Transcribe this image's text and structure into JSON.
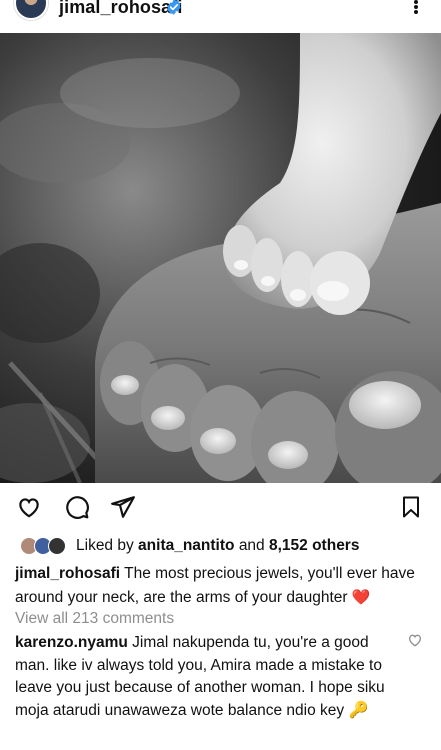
{
  "post": {
    "username": "jimal_rohosafi",
    "verified": true,
    "verified_icon": "verified-badge-icon",
    "more_icon": "more-options-icon"
  },
  "image": {
    "description_icon": "photo",
    "tone": "black-and-white"
  },
  "actions": {
    "like_icon": "heart-outline-icon",
    "comment_icon": "comment-bubble-icon",
    "share_icon": "send-paper-plane-icon",
    "save_icon": "bookmark-icon"
  },
  "likes": {
    "prefix": "Liked by",
    "user": "anita_nantito",
    "connector": "and",
    "others": "8,152 others"
  },
  "caption": {
    "username": "jimal_rohosafi",
    "text": "The most precious jewels, you'll ever have around your neck, are the arms of your daughter",
    "emoji": "❤️"
  },
  "comments_link": "View all 213 comments",
  "comment": {
    "username": "karenzo.nyamu",
    "text": "Jimal nakupenda tu, you're a good man. like iv always told you, Amira made a mistake to leave you just because of another woman. I hope siku moja atarudi unawaweza wote balance ndio key",
    "emoji": "🔑",
    "like_icon": "heart-outline-small-icon"
  },
  "colors": {
    "verified_blue": "#3897f0",
    "heart_red": "#e0182d",
    "muted_gray": "#8e8e8e"
  }
}
